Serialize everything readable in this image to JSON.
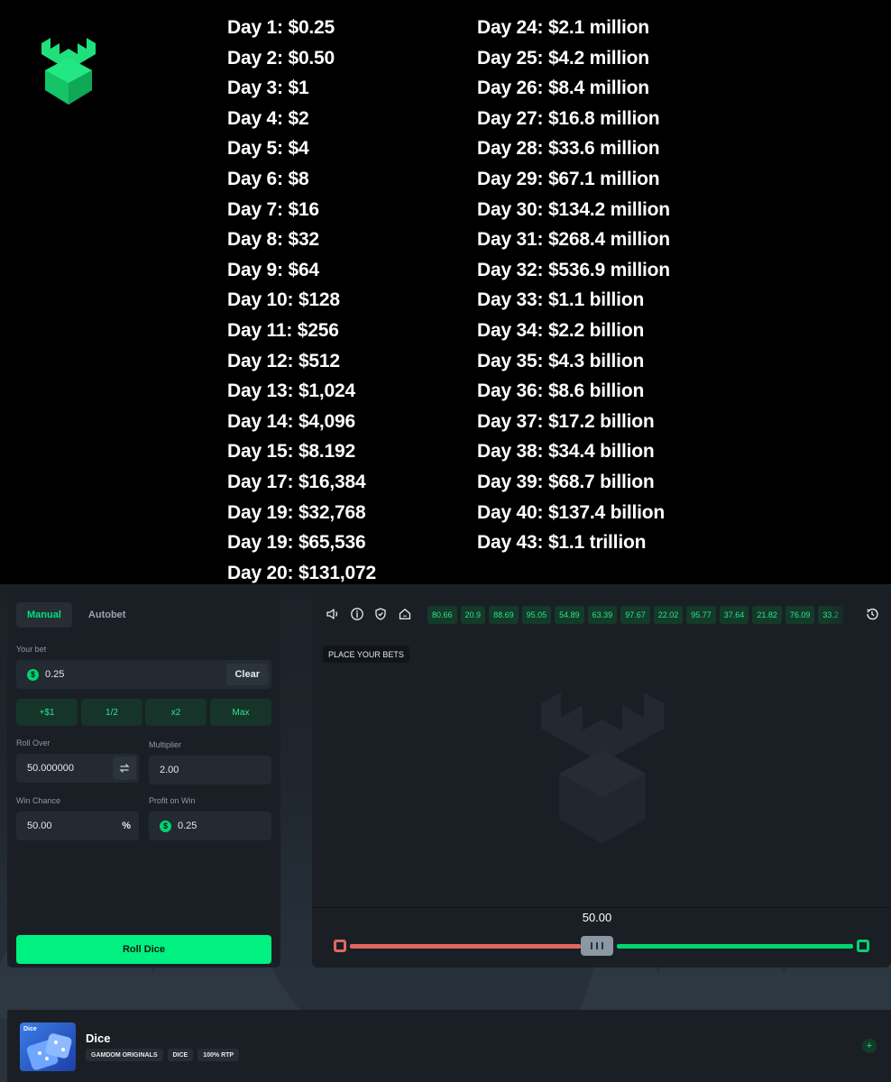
{
  "meme": {
    "left_rows": [
      "Day 1: $0.25",
      "Day 2: $0.50",
      "Day 3: $1",
      "Day 4: $2",
      "Day 5: $4",
      "Day 6: $8",
      "Day 7: $16",
      "Day 8: $32",
      "Day 9: $64",
      "Day 10: $128",
      "Day 11: $256",
      "Day 12: $512",
      "Day 13: $1,024",
      "Day 14: $4,096",
      "Day 15: $8.192",
      "Day 17: $16,384",
      "Day 19: $32,768",
      "Day 19: $65,536",
      "Day 20: $131,072"
    ],
    "right_rows": [
      "Day 24: $2.1 million",
      "Day 25: $4.2 million",
      "Day 26: $8.4 million",
      "Day 27: $16.8 million",
      "Day 28: $33.6 million",
      "Day 29: $67.1 million",
      "Day 30: $134.2 million",
      "Day 31: $268.4 million",
      "Day 32: $536.9 million",
      "Day 33: $1.1 billion",
      "Day 34: $2.2 billion",
      "Day 35: $4.3 billion",
      "Day 36: $8.6 billion",
      "Day 37: $17.2 billion",
      "Day 38: $34.4 billion",
      "Day 39: $68.7 billion",
      "Day 40: $137.4 billion",
      "Day 43: $1.1 trillion"
    ],
    "logo_icon": "castle-logo-icon",
    "accent": "#1fe07a"
  },
  "controls": {
    "tabs": {
      "manual": "Manual",
      "autobet": "Autobet"
    },
    "your_bet_label": "Your bet",
    "bet_value": "0.25",
    "currency_symbol": "$",
    "clear_label": "Clear",
    "quick": {
      "plus1": "+$1",
      "half": "1/2",
      "double": "x2",
      "max": "Max"
    },
    "roll_over_label": "Roll Over",
    "roll_over_value": "50.000000",
    "multiplier_label": "Multiplier",
    "multiplier_value": "2.00",
    "win_chance_label": "Win Chance",
    "win_chance_value": "50.00",
    "percent_symbol": "%",
    "profit_label": "Profit on Win",
    "profit_value": "0.25",
    "roll_button": "Roll Dice",
    "accent": "#00f082"
  },
  "board": {
    "icons": [
      "sound-icon",
      "info-icon",
      "shield-check-icon",
      "home-icon",
      "history-icon"
    ],
    "history": [
      "80.66",
      "20.9",
      "88.69",
      "95.05",
      "54.89",
      "63.39",
      "97.67",
      "22.02",
      "95.77",
      "37.64",
      "21.82",
      "76.09",
      "33.2"
    ],
    "place_bets": "PLACE YOUR BETS",
    "slider_value": "50.00",
    "slider_fraction": 0.5,
    "colors": {
      "lose": "#e0675f",
      "win": "#00d471"
    }
  },
  "footer": {
    "thumb_label": "Dice",
    "title": "Dice",
    "tags": [
      "GAMDOM ORIGINALS",
      "DICE",
      "100% RTP"
    ],
    "fav_symbol": "+"
  }
}
